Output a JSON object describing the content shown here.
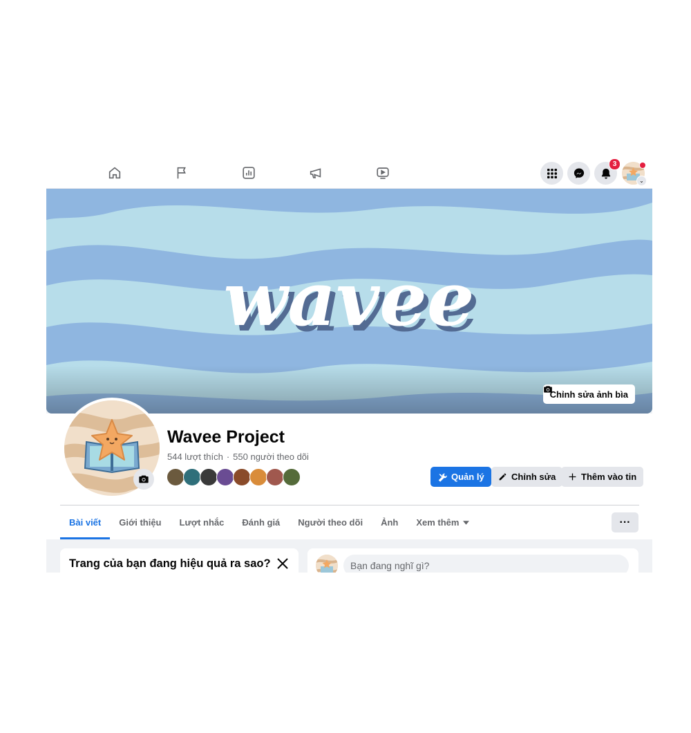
{
  "topnav": {
    "icons": [
      "home-icon",
      "flag-icon",
      "insights-icon",
      "megaphone-icon",
      "video-icon"
    ],
    "right_icons": [
      "menu-grid-icon",
      "messenger-icon",
      "bell-icon"
    ],
    "notifications_count": "3"
  },
  "cover": {
    "title_art": "wavee",
    "edit_button": "Chỉnh sửa ảnh bìa"
  },
  "page": {
    "name": "Wavee Project",
    "likes": "544 lượt thích",
    "separator": "·",
    "followers": "550 người theo dõi"
  },
  "actions": {
    "manage": "Quản lý",
    "edit": "Chỉnh sửa",
    "add_to_story": "Thêm vào tin"
  },
  "tabs": [
    "Bài viết",
    "Giới thiệu",
    "Lượt nhắc",
    "Đánh giá",
    "Người theo dõi",
    "Ảnh",
    "Xem thêm"
  ],
  "more_button": "···",
  "insight_card": {
    "title": "Trang của bạn đang hiệu quả ra sao?"
  },
  "composer": {
    "placeholder": "Bạn đang nghĩ gì?"
  },
  "colors": {
    "accent": "#1b74e4",
    "cover_light": "#b7ddea",
    "cover_dark": "#8fb6e0",
    "notification": "#e41e3f"
  }
}
